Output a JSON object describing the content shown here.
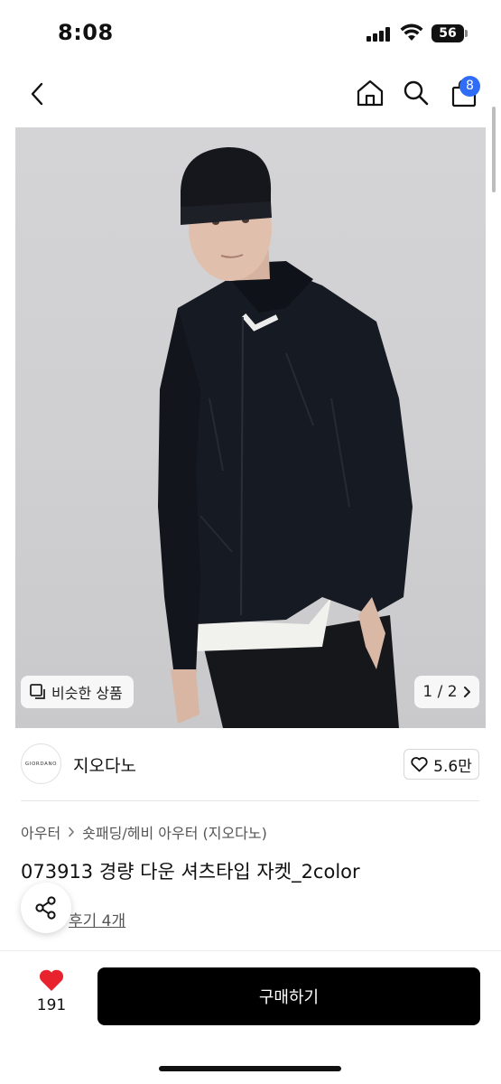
{
  "status_bar": {
    "time": "8:08",
    "battery": "56"
  },
  "header": {
    "cart_count": "8"
  },
  "product_image": {
    "alt": "",
    "similar_label": "비슷한 상품",
    "pager": "1 / 2"
  },
  "brand": {
    "logo_text": "GIORDANO",
    "name": "지오다노",
    "likes": "5.6만"
  },
  "breadcrumb": {
    "level1": "아우터",
    "level2": "숏패딩/헤비 아우터 (지오다노)"
  },
  "product": {
    "title": "073913 경량 다운 셔츠타입 자켓_2color",
    "review_link": "후기 4개"
  },
  "bottom_bar": {
    "wish_count": "191",
    "buy_label": "구매하기"
  },
  "colors": {
    "accent_badge": "#2f6df6",
    "buy_button": "#000000",
    "heart": "#e8232e"
  },
  "icons": [
    "back-icon",
    "home-icon",
    "search-icon",
    "cart-icon",
    "similar-icon",
    "chevron-right-icon",
    "heart-outline-icon",
    "share-icon",
    "heart-filled-icon"
  ]
}
